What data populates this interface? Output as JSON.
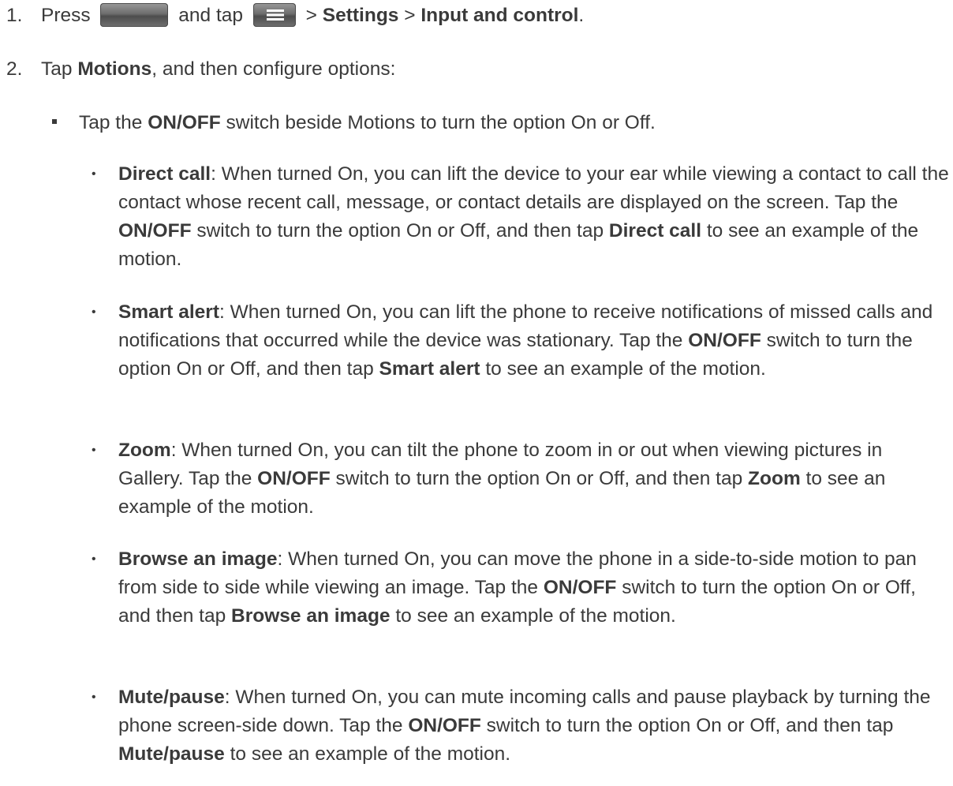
{
  "steps": [
    {
      "number": "1.",
      "pre": "Press",
      "mid": "and tap",
      "sep1": ">",
      "bold1": "Settings",
      "sep2": ">",
      "bold2": "Input and control",
      "end": ".",
      "icons": [
        "home-key-icon",
        "menu-key-icon"
      ]
    },
    {
      "number": "2.",
      "pre": "Tap",
      "bold": "Motions",
      "post": ", and then configure options:"
    }
  ],
  "square_item": {
    "pre": "Tap the",
    "bold": "ON/OFF",
    "post": "switch beside Motions to turn the option On or Off."
  },
  "bullets": [
    {
      "dot": "•",
      "title": "Direct call",
      "t1": ": When turned On, you can lift the device to your ear while viewing a contact to call the contact whose recent call, message, or contact details are displayed on the screen. Tap the",
      "b1": "ON/OFF",
      "t2": "switch to turn the option On or Off, and then tap",
      "b2": "Direct call",
      "t3": "to see an example of the motion."
    },
    {
      "dot": "•",
      "title": "Smart alert",
      "t1": ": When turned On, you can lift the phone to receive notifications of missed calls and notifications that occurred while the device was stationary. Tap the",
      "b1": "ON/OFF",
      "t2": "switch to turn the option On or Off, and then tap",
      "b2": "Smart alert",
      "t3": "to see an example of the motion."
    },
    {
      "dot": "•",
      "title": "Zoom",
      "t1": ": When turned On, you can tilt the phone to zoom in or out when viewing pictures in Gallery. Tap the",
      "b1": "ON/OFF",
      "t2": "switch to turn the option On or Off, and then tap",
      "b2": "Zoom",
      "t3": "to see an example of the motion."
    },
    {
      "dot": "•",
      "title": "Browse an image",
      "t1": ": When turned On, you can move the phone in a side-to-side motion to pan from side to side while viewing an image. Tap the",
      "b1": "ON/OFF",
      "t2": "switch to turn the option On or Off, and then tap",
      "b2": "Browse an image",
      "t3": "to see an example of the motion."
    },
    {
      "dot": "•",
      "title": "Mute/pause",
      "t1": ": When turned On, you can mute incoming calls and pause playback by turning the phone screen-side down. Tap the",
      "b1": "ON/OFF",
      "t2": "switch to turn the option On or Off, and then tap",
      "b2": "Mute/pause",
      "t3": "to see an example of the motion."
    }
  ]
}
